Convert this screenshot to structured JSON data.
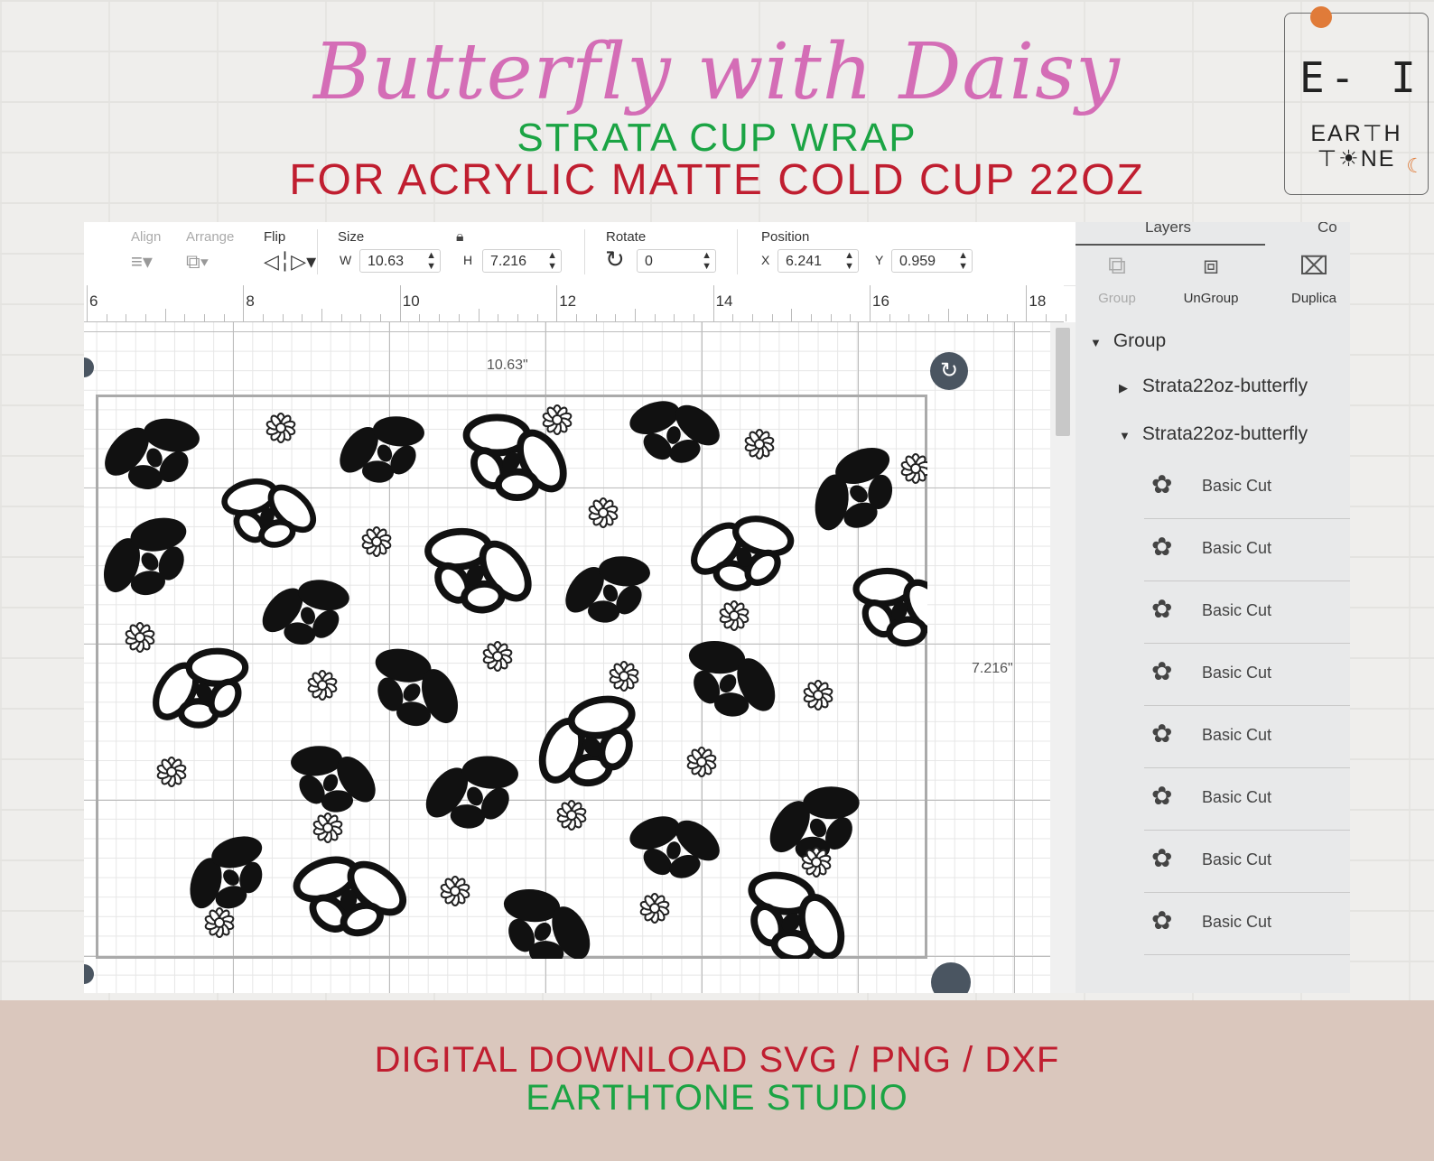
{
  "title": "Butterfly with Daisy",
  "subtitle1": "STRATA CUP WRAP",
  "subtitle2": "FOR ACRYLIC MATTE COLD CUP 22OZ",
  "logo": {
    "mark": "E- I",
    "line1": "EARTH",
    "line2": "ONE",
    "sun_icon": "sun-icon",
    "moon_icon": "moon-icon"
  },
  "toolbar": {
    "align_label": "Align",
    "arrange_label": "Arrange",
    "flip_label": "Flip",
    "size_label": "Size",
    "w_label": "W",
    "w_value": "10.63",
    "h_label": "H",
    "h_value": "7.216",
    "rotate_label": "Rotate",
    "rotate_value": "0",
    "position_label": "Position",
    "x_label": "X",
    "x_value": "6.241",
    "y_label": "Y",
    "y_value": "0.959"
  },
  "ruler": {
    "labels": [
      "6",
      "8",
      "10",
      "12",
      "14",
      "16",
      "18"
    ]
  },
  "canvas": {
    "width_dim": "10.63\"",
    "height_dim": "7.216\""
  },
  "panel": {
    "tab_layers": "Layers",
    "tab_color": "Co",
    "group_btn": "Group",
    "ungroup_btn": "UnGroup",
    "duplicate_btn": "Duplica",
    "tree_group": "Group",
    "tree_item1": "Strata22oz-butterfly",
    "tree_item2": "Strata22oz-butterfly",
    "layers": [
      "Basic Cut",
      "Basic Cut",
      "Basic Cut",
      "Basic Cut",
      "Basic Cut",
      "Basic Cut",
      "Basic Cut",
      "Basic Cut"
    ]
  },
  "footer": {
    "line1": "DIGITAL DOWNLOAD SVG / PNG / DXF",
    "line2": "EARTHTONE STUDIO"
  },
  "colors": {
    "title_pink": "#d46db6",
    "green": "#1ba444",
    "red": "#c01e30",
    "footer_bg": "#dac7bd"
  }
}
